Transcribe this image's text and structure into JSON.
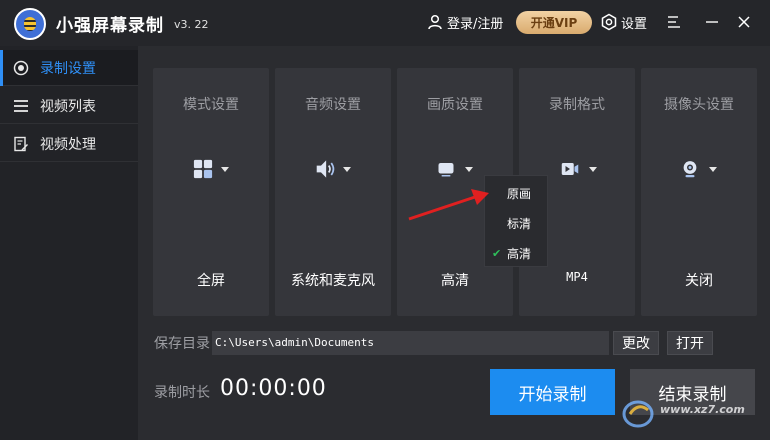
{
  "app": {
    "title": "小强屏幕录制",
    "version": "v3. 22",
    "login_label": "登录/注册",
    "vip_label": "开通VIP",
    "settings_label": "设置"
  },
  "sidebar": {
    "items": [
      {
        "label": "录制设置",
        "icon": "record-icon",
        "active": true
      },
      {
        "label": "视频列表",
        "icon": "list-icon",
        "active": false
      },
      {
        "label": "视频处理",
        "icon": "edit-doc-icon",
        "active": false
      }
    ]
  },
  "cards": [
    {
      "title": "模式设置",
      "value": "全屏",
      "icon": "grid-mode-icon"
    },
    {
      "title": "音频设置",
      "value": "系统和麦克风",
      "icon": "speaker-icon"
    },
    {
      "title": "画质设置",
      "value": "高清",
      "icon": "monitor-icon"
    },
    {
      "title": "录制格式",
      "value": "MP4",
      "icon": "video-icon"
    },
    {
      "title": "摄像头设置",
      "value": "关闭",
      "icon": "webcam-icon"
    }
  ],
  "quality_dropdown": {
    "options": [
      "原画",
      "标清",
      "高清"
    ],
    "selected": "高清"
  },
  "save": {
    "label": "保存目录",
    "path": "C:\\Users\\admin\\Documents",
    "change_label": "更改",
    "open_label": "打开"
  },
  "duration": {
    "label": "录制时长",
    "value": "00:00:00"
  },
  "actions": {
    "start_label": "开始录制",
    "end_label": "结束录制"
  },
  "watermark": {
    "text": "www.xz7.com"
  },
  "colors": {
    "accent": "#1c8cf0",
    "vip": "#e3bb84",
    "check": "#2fbf5b",
    "annotation_arrow": "#e02020"
  }
}
